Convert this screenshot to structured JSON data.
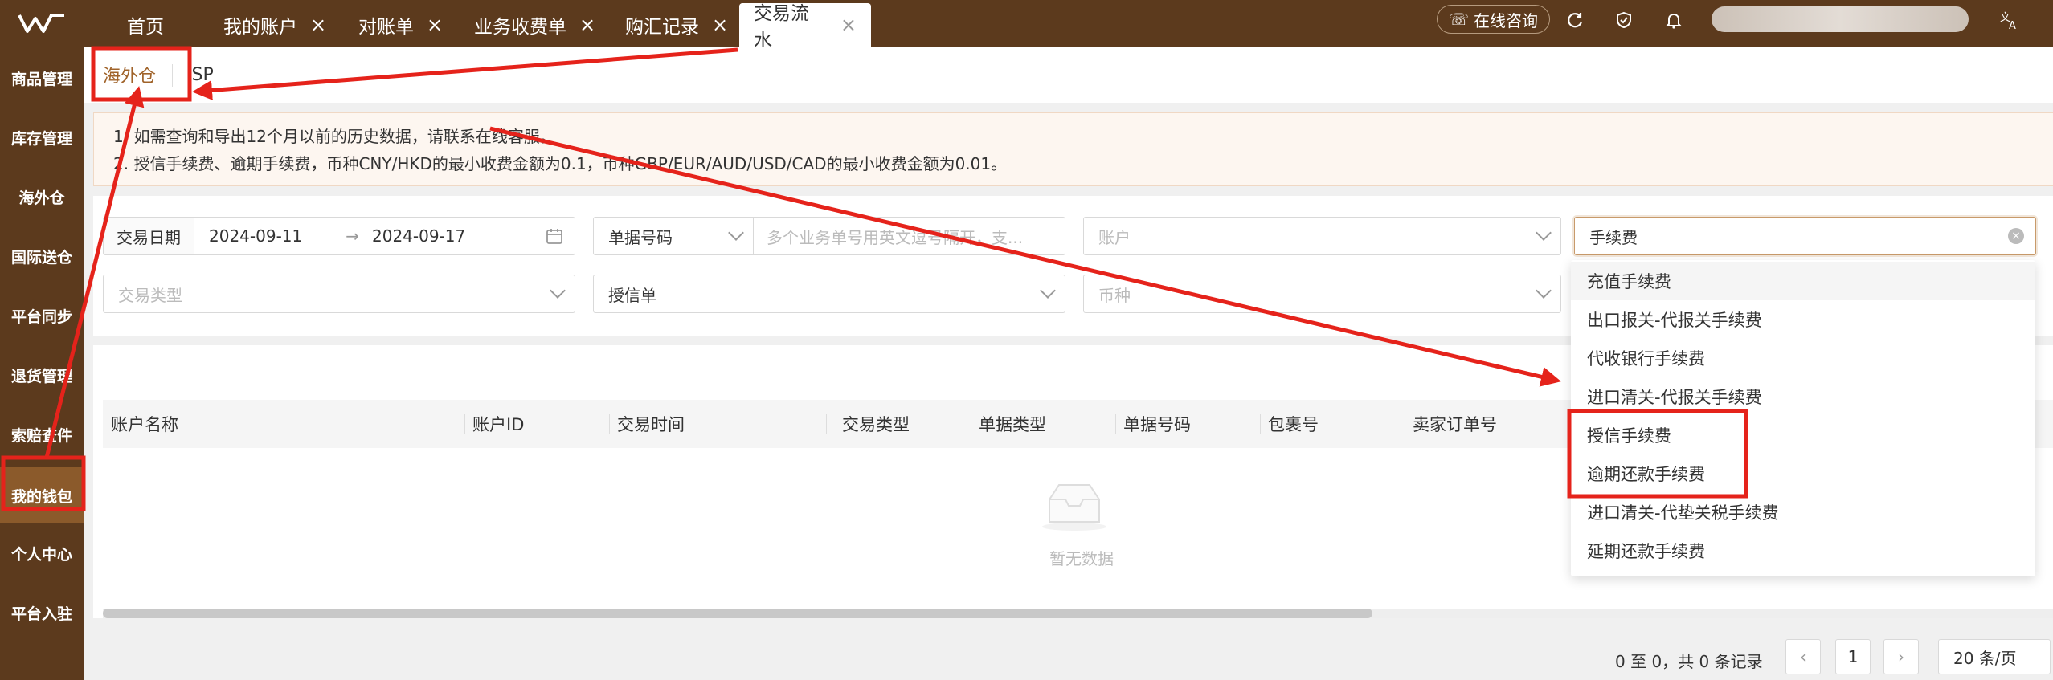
{
  "colors": {
    "brand": "#5c3a1d",
    "accent": "#a0632a",
    "annotation": "#e5231b"
  },
  "header": {
    "tabs": [
      {
        "label": "首页",
        "closable": false
      },
      {
        "label": "我的账户",
        "closable": true
      },
      {
        "label": "对账单",
        "closable": true
      },
      {
        "label": "业务收费单",
        "closable": true
      },
      {
        "label": "购汇记录",
        "closable": true
      },
      {
        "label": "交易流水",
        "closable": true,
        "active": true
      }
    ],
    "consult_label": "在线咨询",
    "icons": [
      "refresh-icon",
      "shield-icon",
      "bell-icon",
      "translate-icon"
    ]
  },
  "sidebar": {
    "items": [
      {
        "label": "商品管理"
      },
      {
        "label": "库存管理"
      },
      {
        "label": "海外仓"
      },
      {
        "label": "国际送仓"
      },
      {
        "label": "平台同步"
      },
      {
        "label": "退货管理"
      },
      {
        "label": "索赔查件"
      },
      {
        "label": "我的钱包",
        "active": true
      },
      {
        "label": "个人中心"
      },
      {
        "label": "平台入驻"
      }
    ]
  },
  "subtabs": [
    {
      "label": "海外仓",
      "active": true
    },
    {
      "label": "ISP"
    }
  ],
  "notice": {
    "lines": [
      "1. 如需查询和导出12个月以前的历史数据，请联系在线客服。",
      "2. 授信手续费、逾期手续费，币种CNY/HKD的最小收费金额为0.1，币种GBP/EUR/AUD/USD/CAD的最小收费金额为0.01。"
    ]
  },
  "filters": {
    "date_label": "交易日期",
    "date_start": "2024-09-11",
    "date_end": "2024-09-17",
    "doc_type_select": "单据号码",
    "doc_number_placeholder": "多个业务单号用英文逗号隔开，支...",
    "account_placeholder": "账户",
    "fee_value": "手续费",
    "trade_type_placeholder": "交易类型",
    "doc_kind_value": "授信单",
    "currency_placeholder": "币种"
  },
  "dropdown": {
    "options": [
      "充值手续费",
      "出口报关-代报关手续费",
      "代收银行手续费",
      "进口清关-代报关手续费",
      "授信手续费",
      "逾期还款手续费",
      "进口清关-代垫关税手续费",
      "延期还款手续费"
    ]
  },
  "table": {
    "columns": [
      "账户名称",
      "账户ID",
      "交易时间",
      "交易类型",
      "单据类型",
      "单据号码",
      "包裹号",
      "卖家订单号"
    ],
    "empty_text": "暂无数据"
  },
  "pagination": {
    "summary": "0 至 0，共 0 条记录",
    "current_page": "1",
    "page_size": "20 条/页"
  }
}
